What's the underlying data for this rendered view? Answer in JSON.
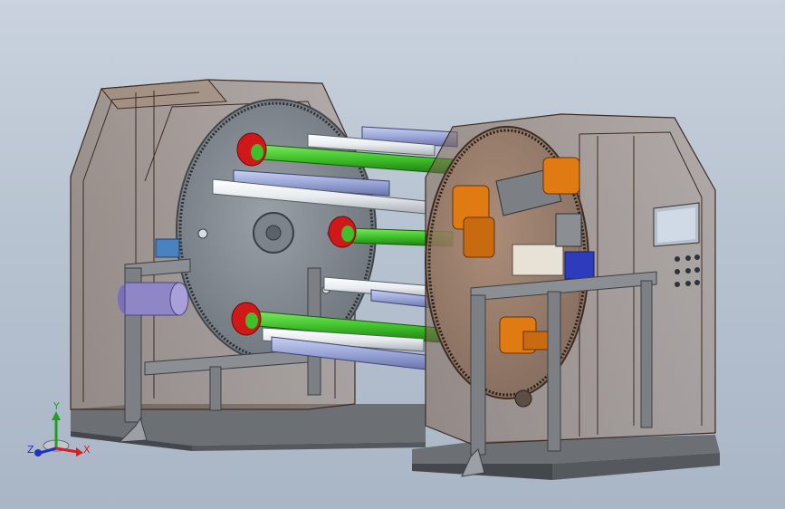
{
  "viewport": {
    "background_top": "#c9d2de",
    "background_bottom": "#a9b6c6"
  },
  "triad": {
    "x_label": "X",
    "y_label": "Y",
    "z_label": "Z",
    "x_color": "#d42020",
    "y_color": "#20a020",
    "z_color": "#2030c8"
  },
  "colors": {
    "frame_glass": "#8a6d58",
    "disc": "#8f959c",
    "rod_green": "#3fbf2a",
    "rod_blue": "#9aa6d8",
    "rod_white": "#e8ecef",
    "motor_orange": "#e07a12",
    "spool_red": "#d01818",
    "base_dark": "#4a4e52"
  }
}
